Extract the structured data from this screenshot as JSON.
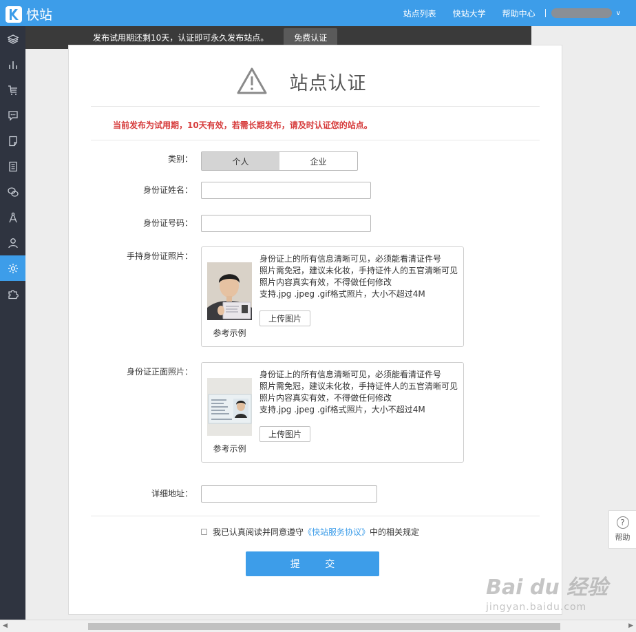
{
  "app": {
    "name": "快站"
  },
  "topnav": {
    "items": [
      "站点列表",
      "快站大学",
      "帮助中心"
    ]
  },
  "notice": {
    "text": "发布试用期还剩10天，认证即可永久发布站点。",
    "button": "免费认证"
  },
  "page": {
    "title": "站点认证",
    "warning": "当前发布为试用期，10天有效，若需长期发布，请及时认证您的站点。"
  },
  "form": {
    "category_label": "类别：",
    "category_options": [
      "个人",
      "企业"
    ],
    "category_selected": "个人",
    "name_label": "身份证姓名：",
    "name_value": "",
    "idnum_label": "身份证号码：",
    "idnum_value": "",
    "handheld_label": "手持身份证照片：",
    "front_label": "身份证正面照片：",
    "address_label": "详细地址：",
    "address_value": "",
    "rules": [
      "身份证上的所有信息清晰可见，必须能看清证件号",
      "照片需免冠，建议未化妆，手持证件人的五官清晰可见",
      "照片内容真实有效，不得做任何修改",
      "支持.jpg .jpeg .gif格式照片，大小不超过4M"
    ],
    "upload_button": "上传图片",
    "sample_caption": "参考示例",
    "agree_prefix": "我已认真阅读并同意遵守",
    "agree_link": "《快站服务协议》",
    "agree_suffix": "中的相关规定",
    "agree_checked": false,
    "submit": "提 交"
  },
  "help": {
    "label": "帮助",
    "symbol": "?"
  },
  "watermark": {
    "line1": "Bai du 经验",
    "line2": "jingyan.baidu.com"
  },
  "colors": {
    "brand": "#3d9de9",
    "sidebar": "#2f3440",
    "notice_bg": "#3a3a3a",
    "warning_text": "#d63b3b"
  },
  "sidebar_icons": [
    "layers-icon",
    "chart-icon",
    "cart-icon",
    "message-icon",
    "page-edit-icon",
    "list-icon",
    "chat-icon",
    "compass-icon",
    "user-icon",
    "gear-icon",
    "puzzle-icon"
  ],
  "sidebar_active": "gear-icon"
}
